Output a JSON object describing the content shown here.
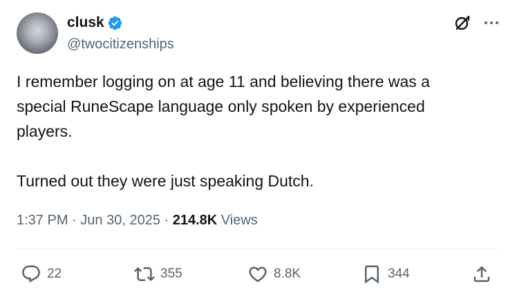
{
  "author": {
    "display_name": "clusk",
    "handle": "@twocitizenships",
    "verified": true
  },
  "tweet": {
    "text": "I remember logging on at age 11 and believing there was a\nspecial RuneScape language only spoken by experienced\nplayers.\n\nTurned out they were just speaking Dutch."
  },
  "meta": {
    "time": "1:37 PM",
    "separator": "·",
    "date": "Jun 30, 2025",
    "views_count": "214.8K",
    "views_label": "Views"
  },
  "actions": {
    "reply_count": "22",
    "repost_count": "355",
    "like_count": "8.8K",
    "bookmark_count": "344"
  },
  "icons": [
    "verified-badge-icon",
    "grok-icon",
    "more-icon",
    "reply-icon",
    "repost-icon",
    "like-icon",
    "bookmark-icon",
    "share-icon"
  ],
  "colors": {
    "verified": "#1d9bf0",
    "text_primary": "#0f1419",
    "text_secondary": "#536471",
    "divider": "#eff3f4"
  }
}
